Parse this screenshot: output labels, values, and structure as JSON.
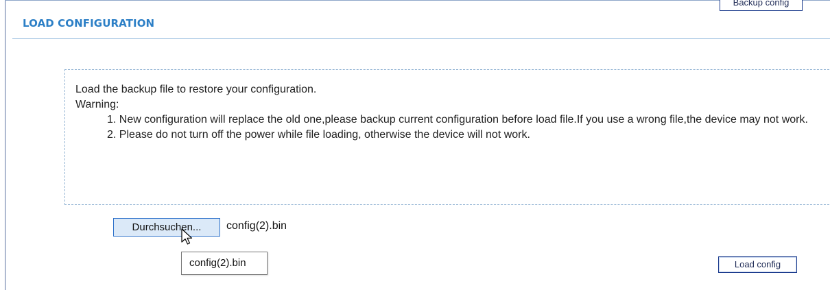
{
  "header": {
    "backup_label": "Backup config",
    "title": "LOAD CONFIGURATION"
  },
  "info": {
    "intro": "Load the backup file to restore your configuration.",
    "warning_label": "Warning:",
    "items": [
      "1. New configuration will replace the old one,please backup current configuration before load file.If you use a wrong file,the device may not work.",
      "2. Please do not turn off the power while file loading, otherwise the device will not work."
    ]
  },
  "file_input": {
    "browse_label": "Durchsuchen...",
    "selected_file": "config(2).bin",
    "tooltip": "config(2).bin"
  },
  "actions": {
    "load_label": "Load config"
  },
  "colors": {
    "title": "#2c7fc6",
    "button_border": "#1a3a8c",
    "browse_bg": "#dbe9f8",
    "dashed_border": "#8fb1d2"
  },
  "icons": {
    "cursor": "arrow-cursor-icon"
  }
}
